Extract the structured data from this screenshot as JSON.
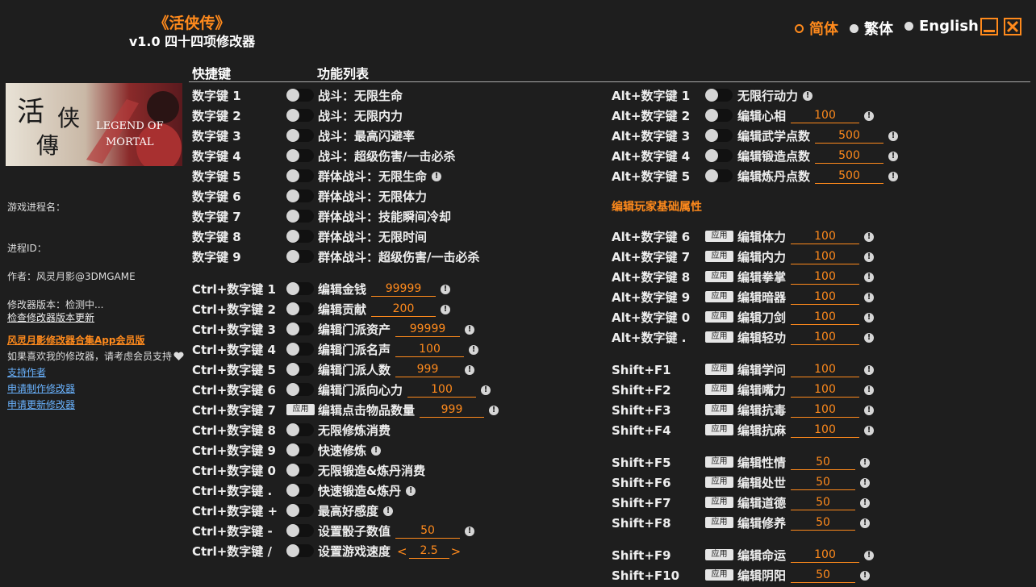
{
  "header": {
    "title": "《活侠传》",
    "subtitle": "v1.0 四十四项修改器",
    "languages": [
      {
        "label": "简体",
        "selected": true
      },
      {
        "label": "繁体",
        "selected": false
      },
      {
        "label": "English",
        "selected": false
      }
    ],
    "accent_color": "#ff8a1c"
  },
  "sidebar": {
    "process_name_label": "游戏进程名：",
    "process_id_label": "进程ID：",
    "author": "作者：风灵月影@3DMGAME",
    "version_label": "修改器版本：检测中...",
    "check_update": "检查修改器版本更新",
    "app_promo": "风灵月影修改器合集App会员版",
    "support_text": "如果喜欢我的修改器，请考虑会员支持",
    "links": [
      "支持作者",
      "申请制作修改器",
      "申请更新修改器"
    ],
    "cover_text": [
      "活",
      "侠",
      "傳",
      "LEGEND OF",
      "MORTAL"
    ]
  },
  "columns": {
    "hotkey": "快捷键",
    "features": "功能列表"
  },
  "left_rows": [
    {
      "key": "数字键 1",
      "control": "toggle",
      "label": "战斗：无限生命"
    },
    {
      "key": "数字键 2",
      "control": "toggle",
      "label": "战斗：无限内力"
    },
    {
      "key": "数字键 3",
      "control": "toggle",
      "label": "战斗：最高闪避率"
    },
    {
      "key": "数字键 4",
      "control": "toggle",
      "label": "战斗：超级伤害/一击必杀"
    },
    {
      "key": "数字键 5",
      "control": "toggle",
      "label": "群体战斗：无限生命",
      "warn": true
    },
    {
      "key": "数字键 6",
      "control": "toggle",
      "label": "群体战斗：无限体力"
    },
    {
      "key": "数字键 7",
      "control": "toggle",
      "label": "群体战斗：技能瞬间冷却"
    },
    {
      "key": "数字键 8",
      "control": "toggle",
      "label": "群体战斗：无限时间"
    },
    {
      "key": "数字键 9",
      "control": "toggle",
      "label": "群体战斗：超级伤害/一击必杀"
    },
    {
      "key": "Ctrl+数字键 1",
      "control": "toggle",
      "label": "编辑金钱",
      "value": "99999",
      "warn": true
    },
    {
      "key": "Ctrl+数字键 2",
      "control": "toggle",
      "label": "编辑贡献",
      "value": "200",
      "warn": true
    },
    {
      "key": "Ctrl+数字键 3",
      "control": "toggle",
      "label": "编辑门派资产",
      "value": "99999",
      "warn": true
    },
    {
      "key": "Ctrl+数字键 4",
      "control": "toggle",
      "label": "编辑门派名声",
      "value": "100",
      "warn": true
    },
    {
      "key": "Ctrl+数字键 5",
      "control": "toggle",
      "label": "编辑门派人数",
      "value": "999",
      "warn": true
    },
    {
      "key": "Ctrl+数字键 6",
      "control": "toggle",
      "label": "编辑门派向心力",
      "value": "100",
      "warn": true
    },
    {
      "key": "Ctrl+数字键 7",
      "control": "apply",
      "label": "编辑点击物品数量",
      "value": "999",
      "warn": true
    },
    {
      "key": "Ctrl+数字键 8",
      "control": "toggle",
      "label": "无限修炼消费"
    },
    {
      "key": "Ctrl+数字键 9",
      "control": "toggle",
      "label": "快速修炼",
      "warn": true
    },
    {
      "key": "Ctrl+数字键 0",
      "control": "toggle",
      "label": "无限锻造&炼丹消费"
    },
    {
      "key": "Ctrl+数字键 .",
      "control": "toggle",
      "label": "快速锻造&炼丹",
      "warn": true
    },
    {
      "key": "Ctrl+数字键 +",
      "control": "toggle",
      "label": "最高好感度",
      "warn": true
    },
    {
      "key": "Ctrl+数字键 -",
      "control": "toggle",
      "label": "设置骰子数值",
      "value": "50",
      "warn": true
    },
    {
      "key": "Ctrl+数字键 /",
      "control": "toggle",
      "label": "设置游戏速度",
      "value": "2.5",
      "stepper": true
    }
  ],
  "right_rows": [
    {
      "key": "Alt+数字键 1",
      "control": "toggle",
      "label": "无限行动力",
      "warn": true
    },
    {
      "key": "Alt+数字键 2",
      "control": "toggle",
      "label": "编辑心相",
      "value": "100",
      "warn": true
    },
    {
      "key": "Alt+数字键 3",
      "control": "toggle",
      "label": "编辑武学点数",
      "value": "500",
      "warn": true
    },
    {
      "key": "Alt+数字键 4",
      "control": "toggle",
      "label": "编辑锻造点数",
      "value": "500",
      "warn": true
    },
    {
      "key": "Alt+数字键 5",
      "control": "toggle",
      "label": "编辑炼丹点数",
      "value": "500",
      "warn": true
    },
    {
      "key": "Alt+数字键 6",
      "control": "apply",
      "label": "编辑体力",
      "value": "100",
      "warn": true
    },
    {
      "key": "Alt+数字键 7",
      "control": "apply",
      "label": "编辑内力",
      "value": "100",
      "warn": true
    },
    {
      "key": "Alt+数字键 8",
      "control": "apply",
      "label": "编辑拳掌",
      "value": "100",
      "warn": true
    },
    {
      "key": "Alt+数字键 9",
      "control": "apply",
      "label": "编辑暗器",
      "value": "100",
      "warn": true
    },
    {
      "key": "Alt+数字键 0",
      "control": "apply",
      "label": "编辑刀剑",
      "value": "100",
      "warn": true
    },
    {
      "key": "Alt+数字键 .",
      "control": "apply",
      "label": "编辑轻功",
      "value": "100",
      "warn": true
    },
    {
      "key": "Shift+F1",
      "control": "apply",
      "label": "编辑学问",
      "value": "100",
      "warn": true
    },
    {
      "key": "Shift+F2",
      "control": "apply",
      "label": "编辑嘴力",
      "value": "100",
      "warn": true
    },
    {
      "key": "Shift+F3",
      "control": "apply",
      "label": "编辑抗毒",
      "value": "100",
      "warn": true
    },
    {
      "key": "Shift+F4",
      "control": "apply",
      "label": "编辑抗麻",
      "value": "100",
      "warn": true
    },
    {
      "key": "Shift+F5",
      "control": "apply",
      "label": "编辑性情",
      "value": "50",
      "warn": true
    },
    {
      "key": "Shift+F6",
      "control": "apply",
      "label": "编辑处世",
      "value": "50",
      "warn": true
    },
    {
      "key": "Shift+F7",
      "control": "apply",
      "label": "编辑道德",
      "value": "50",
      "warn": true
    },
    {
      "key": "Shift+F8",
      "control": "apply",
      "label": "编辑修养",
      "value": "50",
      "warn": true
    },
    {
      "key": "Shift+F9",
      "control": "apply",
      "label": "编辑命运",
      "value": "100",
      "warn": true
    },
    {
      "key": "Shift+F10",
      "control": "apply",
      "label": "编辑阴阳",
      "value": "50",
      "warn": true
    }
  ],
  "section_label": "编辑玩家基础属性",
  "apply_label": "应用"
}
